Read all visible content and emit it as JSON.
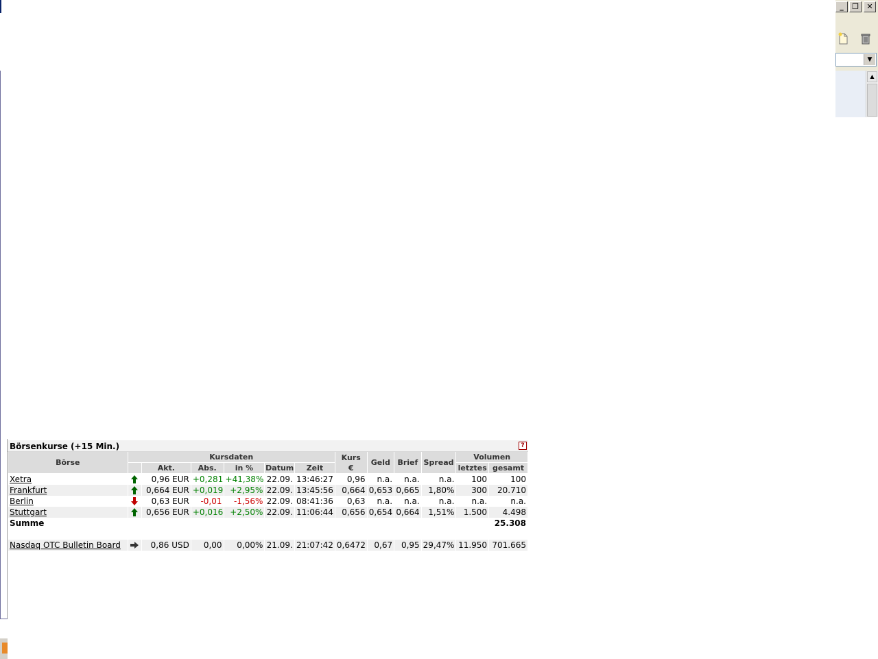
{
  "window_controls": {
    "minimize": "_",
    "restore": "❐",
    "close": "✕"
  },
  "toolbar_icons": [
    "new-document-icon",
    "trash-icon"
  ],
  "quote_box": {
    "title": "Börsenkurse (+15 Min.)",
    "help_label": "?",
    "headers": {
      "boerse": "Börse",
      "kursdaten": "Kursdaten",
      "akt": "Akt.",
      "abs": "Abs.",
      "in_pct": "in %",
      "datum": "Datum",
      "zeit": "Zeit",
      "kurs_line1": "Kurs",
      "kurs_line2": "€",
      "geld": "Geld",
      "brief": "Brief",
      "spread": "Spread",
      "volumen": "Volumen",
      "letztes": "letztes",
      "gesamt": "gesamt"
    },
    "rows": [
      {
        "exchange": "Xetra",
        "trend": "up",
        "akt": "0,96 EUR",
        "abs": "+0,281",
        "pct": "+41,38%",
        "datum": "22.09.",
        "zeit": "13:46:27",
        "kurs": "0,96",
        "geld": "n.a.",
        "brief": "n.a.",
        "spread": "n.a.",
        "letztes": "100",
        "gesamt": "100"
      },
      {
        "exchange": "Frankfurt",
        "trend": "up",
        "akt": "0,664 EUR",
        "abs": "+0,019",
        "pct": "+2,95%",
        "datum": "22.09.",
        "zeit": "13:45:56",
        "kurs": "0,664",
        "geld": "0,653",
        "brief": "0,665",
        "spread": "1,80%",
        "letztes": "300",
        "gesamt": "20.710"
      },
      {
        "exchange": "Berlin",
        "trend": "down",
        "akt": "0,63 EUR",
        "abs": "-0,01",
        "pct": "-1,56%",
        "datum": "22.09.",
        "zeit": "08:41:36",
        "kurs": "0,63",
        "geld": "n.a.",
        "brief": "n.a.",
        "spread": "n.a.",
        "letztes": "n.a.",
        "gesamt": "n.a."
      },
      {
        "exchange": "Stuttgart",
        "trend": "up",
        "akt": "0,656 EUR",
        "abs": "+0,016",
        "pct": "+2,50%",
        "datum": "22.09.",
        "zeit": "11:06:44",
        "kurs": "0,656",
        "geld": "0,654",
        "brief": "0,664",
        "spread": "1,51%",
        "letztes": "1.500",
        "gesamt": "4.498"
      }
    ],
    "summe_label": "Summe",
    "summe_value": "25.308",
    "otc_row": {
      "exchange": "Nasdaq OTC Bulletin Board",
      "trend": "flat",
      "akt": "0,86 USD",
      "abs": "0,00",
      "pct": "0,00%",
      "datum": "21.09.",
      "zeit": "21:07:42",
      "kurs": "0,6472",
      "geld": "0,67",
      "brief": "0,95",
      "spread": "29,47%",
      "letztes": "11.950",
      "gesamt": "701.665"
    },
    "colors": {
      "positive": "#008000",
      "negative": "#cc0000",
      "header_bg": "#dcdcdc"
    }
  }
}
